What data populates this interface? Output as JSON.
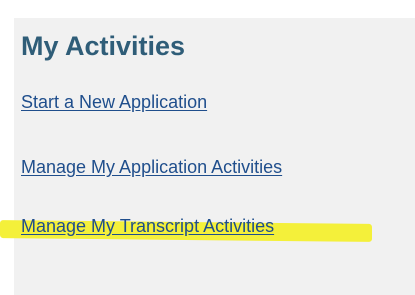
{
  "section": {
    "title": "My Activities"
  },
  "links": [
    {
      "label": "Start a New Application"
    },
    {
      "label": "Manage My Application Activities"
    },
    {
      "label": "Manage My Transcript Activities"
    }
  ],
  "colors": {
    "panel_bg": "#f1f1f1",
    "title": "#2f5d78",
    "link": "#1f4e8c",
    "highlight": "#f4f03a"
  }
}
